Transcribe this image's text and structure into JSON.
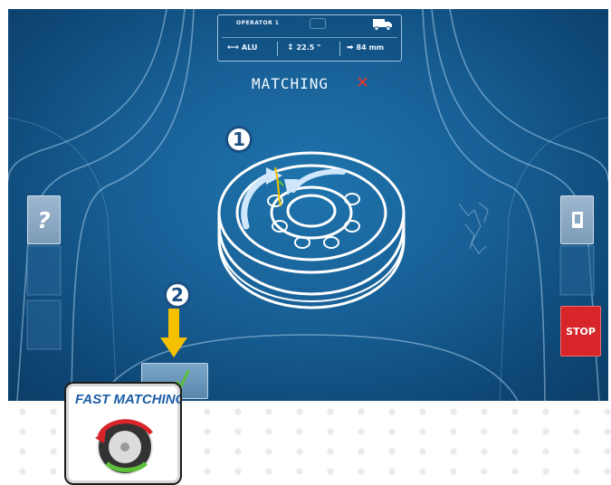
{
  "header": {
    "operator_name": "OPERATOR 1",
    "measurements": [
      {
        "icon": "rim-type-icon",
        "value": "ALU"
      },
      {
        "icon": "rim-diameter-icon",
        "value": "22.5 \""
      },
      {
        "icon": "rim-width-icon",
        "value": "84 mm"
      }
    ],
    "vehicle_icon": "truck-icon"
  },
  "screen_title": "MATCHING",
  "steps": [
    "1",
    "2"
  ],
  "buttons": {
    "help_label": "?",
    "stop_label": "STOP"
  },
  "logo": {
    "text": "FAST MATCHING"
  },
  "colors": {
    "screen_bg": "#175f95",
    "accent_red": "#d8252a",
    "arrow_yellow": "#f5c000",
    "check_green": "#5fbf3a"
  }
}
